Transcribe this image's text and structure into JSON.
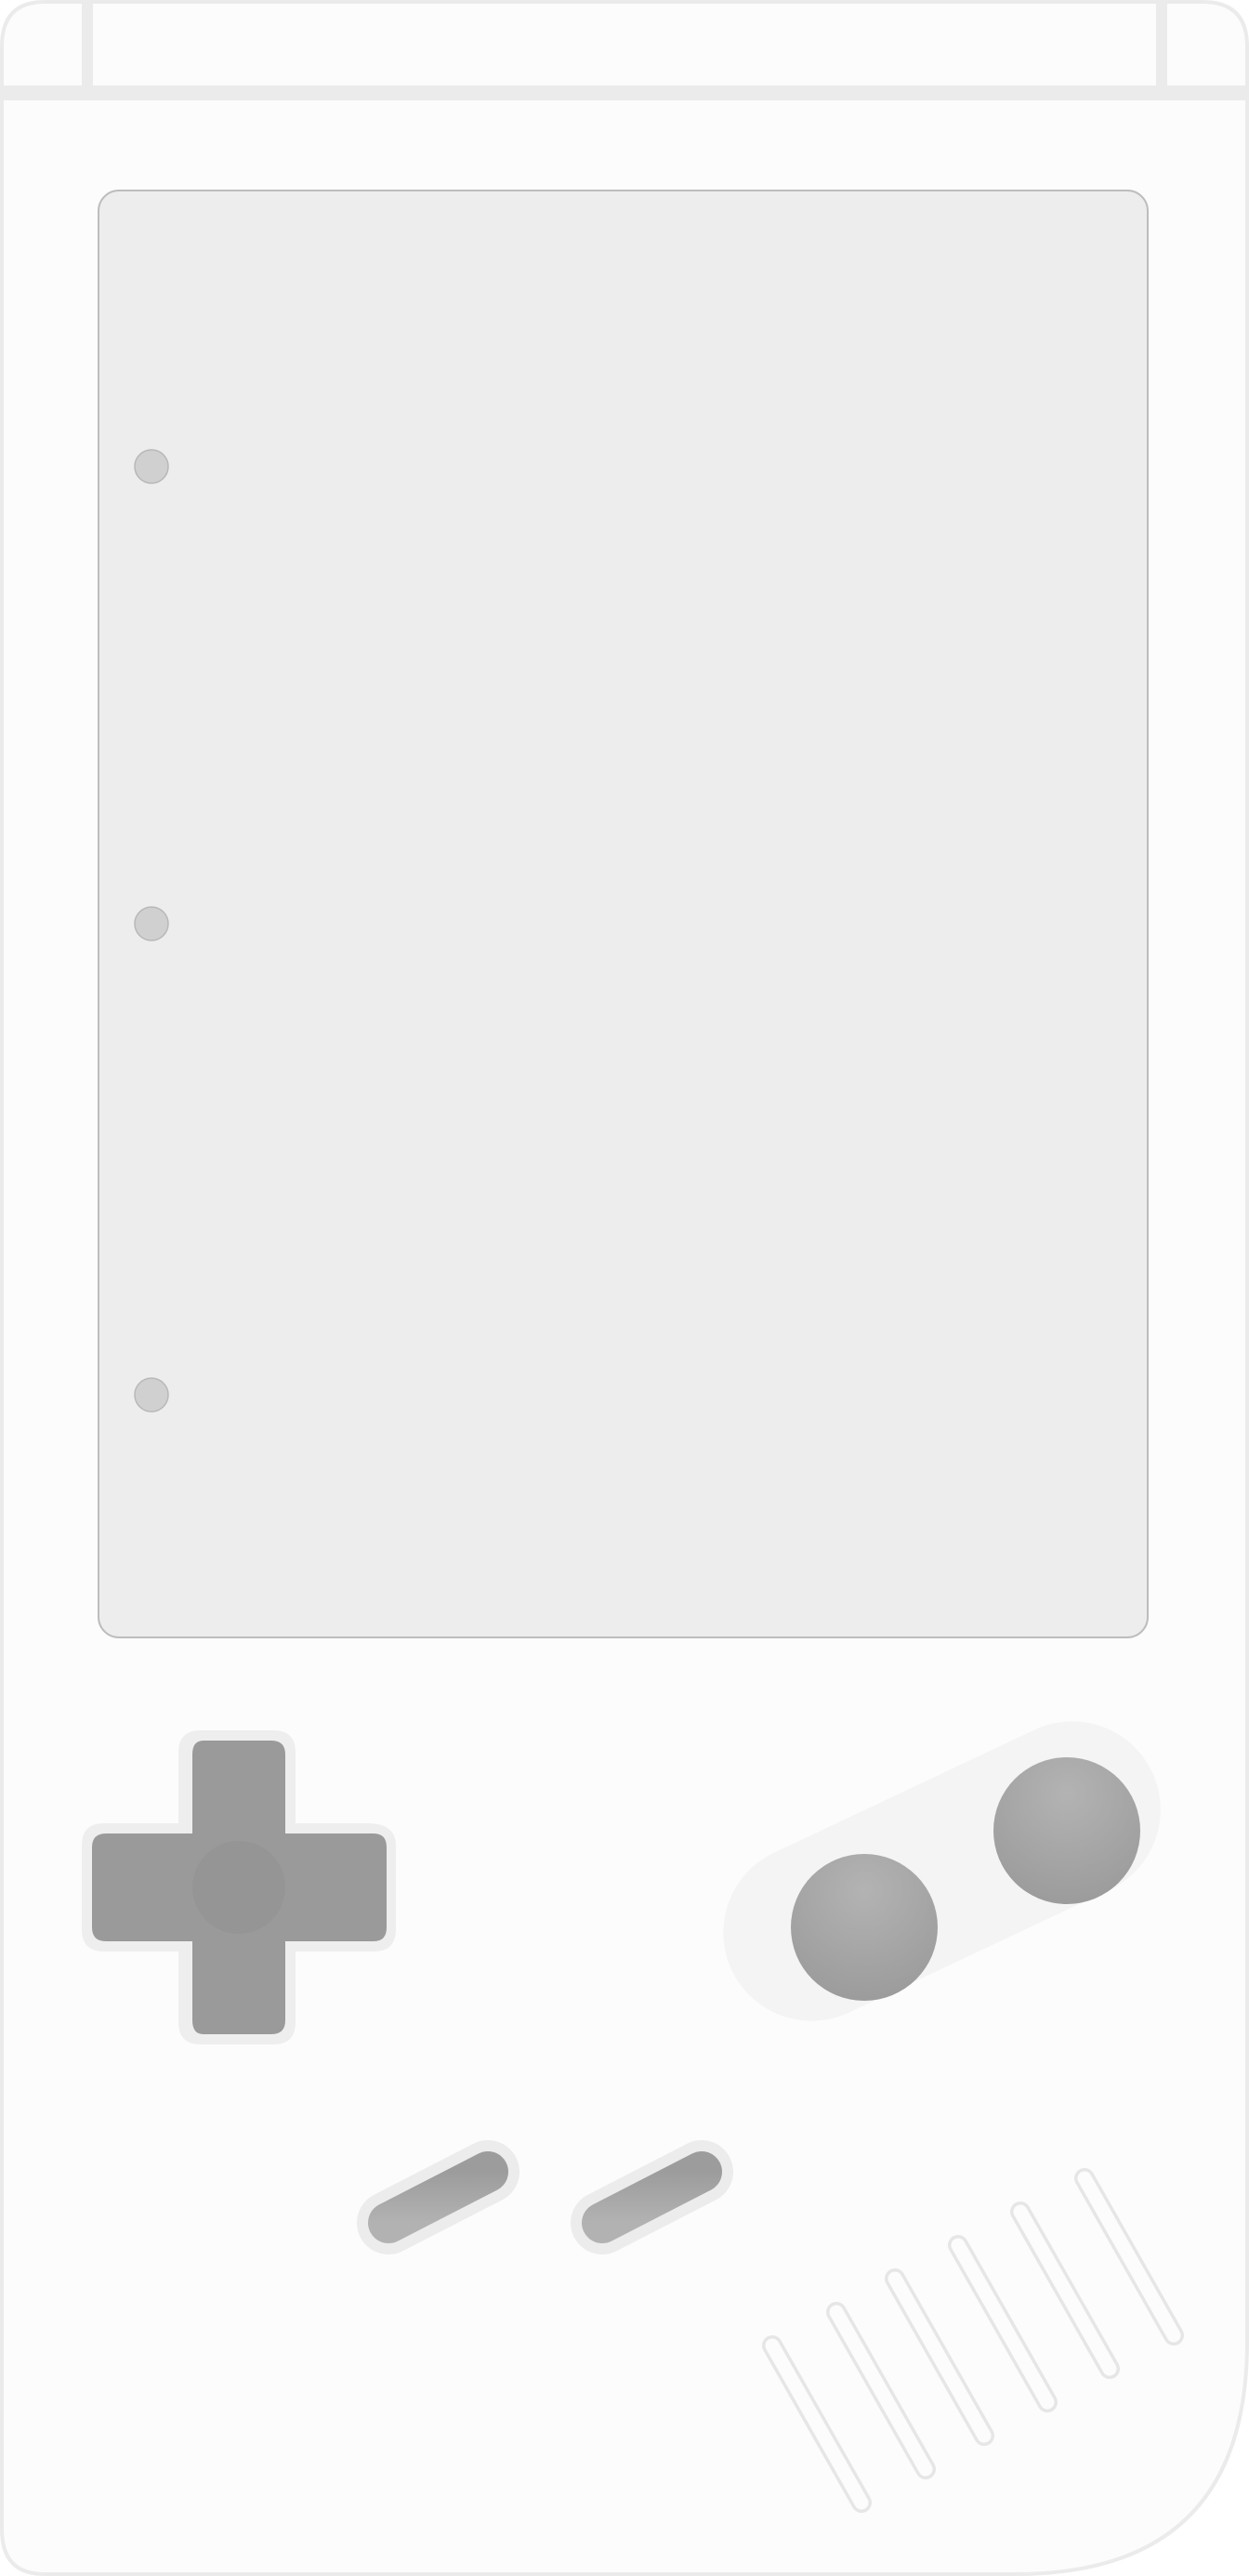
{
  "device": {
    "body_color": "#fcfcfc",
    "outline_color": "#ebebeb",
    "screen_color": "#ededed",
    "screen_border_color": "#bdbdbd",
    "indicator_color": "#d0d0d0",
    "dpad_color": "#9a9a9a",
    "action_button_color": "#a5a5a5",
    "pill_color": "#a3a3a3"
  },
  "screen": {
    "indicator_count": 3
  },
  "controls": {
    "dpad": {
      "icon": "dpad-icon"
    },
    "buttons": [
      {
        "name": "a-button"
      },
      {
        "name": "b-button"
      }
    ],
    "start_select": [
      {
        "name": "select-button"
      },
      {
        "name": "start-button"
      }
    ]
  },
  "speaker": {
    "slot_count": 6
  }
}
